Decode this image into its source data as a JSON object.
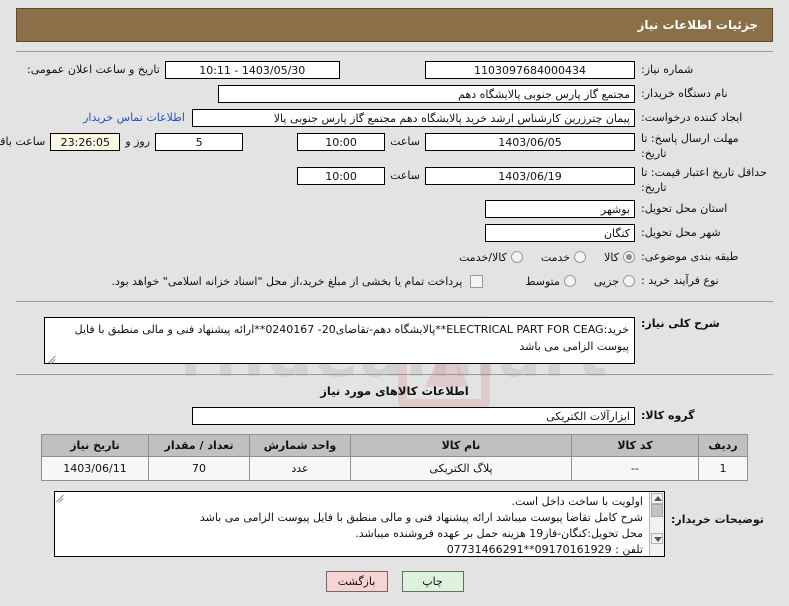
{
  "header": {
    "title": "جزئیات اطلاعات نیاز"
  },
  "form": {
    "need_number_label": "شماره نیاز:",
    "need_number_value": "1103097684000434",
    "public_announce_label": "تاریخ و ساعت اعلان عمومی:",
    "public_announce_value": "1403/05/30 - 10:11",
    "buyer_org_label": "نام دستگاه خریدار:",
    "buyer_org_value": "مجتمع گاز پارس جنوبی  پالایشگاه دهم",
    "requester_label": "ایجاد کننده درخواست:",
    "requester_value": "پیمان چترزرین کارشناس ارشد خرید پالایشگاه دهم مجتمع گاز پارس جنوبی  پالا",
    "contact_link": "اطلاعات تماس خریدار",
    "response_deadline_label": "مهلت ارسال پاسخ: تا تاریخ:",
    "response_deadline_date": "1403/06/05",
    "response_deadline_hour_label": "ساعت",
    "response_deadline_time": "10:00",
    "remaining_days": "5",
    "remaining_days_label": "روز و",
    "remaining_time": "23:26:05",
    "remaining_time_label": "ساعت باقي مانده",
    "price_validity_label": "حداقل تاریخ اعتبار قیمت: تا تاریخ:",
    "price_validity_date": "1403/06/19",
    "price_validity_hour_label": "ساعت",
    "price_validity_time": "10:00",
    "province_label": "استان محل تحویل:",
    "province_value": "بوشهر",
    "city_label": "شهر محل تحویل:",
    "city_value": "کنگان",
    "category_label": "طبقه بندی موضوعی:",
    "category_options": [
      {
        "label": "کالا",
        "selected": true
      },
      {
        "label": "خدمت",
        "selected": false
      },
      {
        "label": "کالا/خدمت",
        "selected": false
      }
    ],
    "process_type_label": "نوع فرآیند خرید :",
    "process_type_options": [
      {
        "label": "جزیی",
        "selected": false
      },
      {
        "label": "متوسط",
        "selected": false
      }
    ],
    "treasury_checkbox_note": "پرداخت تمام یا بخشی از مبلغ خرید،از محل \"اسناد خزانه اسلامی\" خواهد بود.",
    "summary_label": "شرح کلی نیاز:",
    "summary_value": "خرید:ELECTRICAL PART FOR CEAG**پالایشگاه دهم-تقاضای20- 0240167**ارائه پیشنهاد فنی و مالی منطبق با فایل پیوست الزامی می باشد"
  },
  "goods_section": {
    "heading": "اطلاعات کالاهای مورد نیاز",
    "group_label": "گروه کالا:",
    "group_value": "ابزارآلات الکتریکی",
    "columns": [
      "ردیف",
      "کد کالا",
      "نام کالا",
      "واحد شمارش",
      "تعداد / مقدار",
      "تاریخ نیاز"
    ],
    "rows": [
      {
        "radif": "1",
        "code": "--",
        "name": "پلاگ الکتریکی",
        "unit": "عدد",
        "quantity": "70",
        "need_date": "1403/06/11"
      }
    ]
  },
  "notes": {
    "label": "توضیحات خریدار:",
    "text": "اولویت با ساخت داخل است.\nشرح کامل تقاضا پیوست میباشد ارائه پیشنهاد فنی و مالی منطبق با فایل پیوست الزامی می باشد\nمحل تحویل:کنگان-فاز19 هزینه حمل بر عهده فروشنده میباشد.\nتلفن : 09170161929**07731466291"
  },
  "footer": {
    "print_label": "چاپ",
    "back_label": "بازگشت"
  },
  "watermark": {
    "text": "rfidealmart"
  },
  "colors": {
    "header_band": "#8b6f47",
    "page_background": "#e3e3e3",
    "link": "#2a4fc4",
    "print_button": "#ddf2dc",
    "back_button": "#f8d3d3",
    "table_header": "#c0c0c0",
    "countdown_field": "#fbf8e3"
  }
}
